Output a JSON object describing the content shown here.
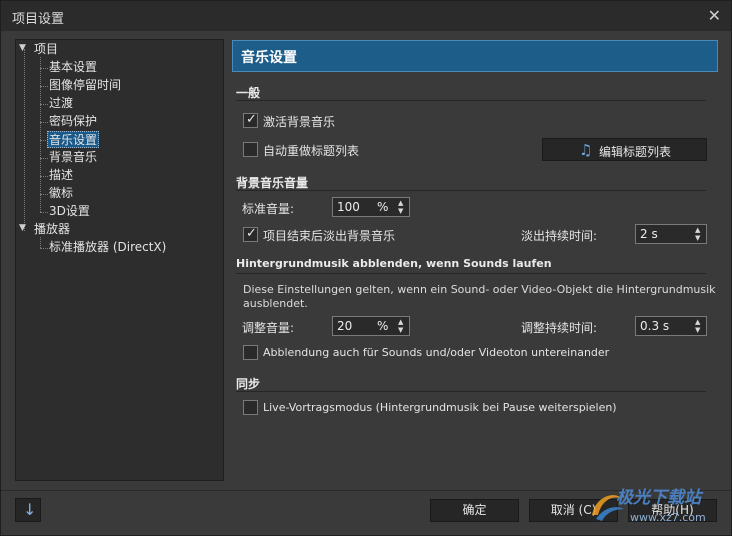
{
  "window": {
    "title": "项目设置"
  },
  "tree": {
    "items": [
      {
        "label": "项目"
      },
      {
        "label": "基本设置"
      },
      {
        "label": "图像停留时间"
      },
      {
        "label": "过渡"
      },
      {
        "label": "密码保护"
      },
      {
        "label": "音乐设置"
      },
      {
        "label": "背景音乐"
      },
      {
        "label": "描述"
      },
      {
        "label": "徽标"
      },
      {
        "label": "3D设置"
      },
      {
        "label": "播放器"
      },
      {
        "label": "标准播放器 (DirectX)"
      }
    ],
    "selected": "音乐设置"
  },
  "panel": {
    "title": "音乐设置"
  },
  "general": {
    "title": "一般",
    "activate_bg_music": {
      "label": "激活背景音乐",
      "checked": true
    },
    "auto_remake": {
      "label": "自动重做标题列表",
      "checked": false
    },
    "edit_titlelist": {
      "label": "编辑标题列表"
    }
  },
  "volume": {
    "title": "背景音乐音量",
    "standard_label": "标准音量:",
    "standard_value": "100",
    "standard_unit": "%",
    "fade_out": {
      "label": "项目结束后淡出背景音乐",
      "checked": true
    },
    "fade_duration_label": "淡出持续时间:",
    "fade_duration_value": "2 s"
  },
  "ducking": {
    "title": "Hintergrundmusik abblenden, wenn Sounds laufen",
    "desc_line1": "Diese Einstellungen gelten, wenn ein Sound- oder Video-Objekt die Hintergrundmusik",
    "desc_line2": "ausblendet.",
    "adjust_label": "调整音量:",
    "adjust_value": "20",
    "adjust_unit": "%",
    "adjust_duration_label": "调整持续时间:",
    "adjust_duration_value": "0.3 s",
    "mutual": {
      "label": "Abblendung auch für Sounds und/oder Videoton untereinander",
      "checked": false
    }
  },
  "sync": {
    "title": "同步",
    "live_mode": {
      "label": "Live-Vortragsmodus (Hintergrundmusik bei Pause weiterspielen)",
      "checked": false
    }
  },
  "footer": {
    "ok_label": "确定",
    "cancel_label": "取消 (C)",
    "help_label": "帮助(H)"
  },
  "watermark": {
    "main": "极光下载站",
    "sub": "www.xz7.com"
  },
  "colors": {
    "accent": "#1d5d8a",
    "background": "#3a3a3a",
    "panel": "#2d2d2d"
  },
  "icons": {
    "close": "close-icon",
    "music": "music-note-icon",
    "down_arrow": "down-arrow-icon"
  }
}
